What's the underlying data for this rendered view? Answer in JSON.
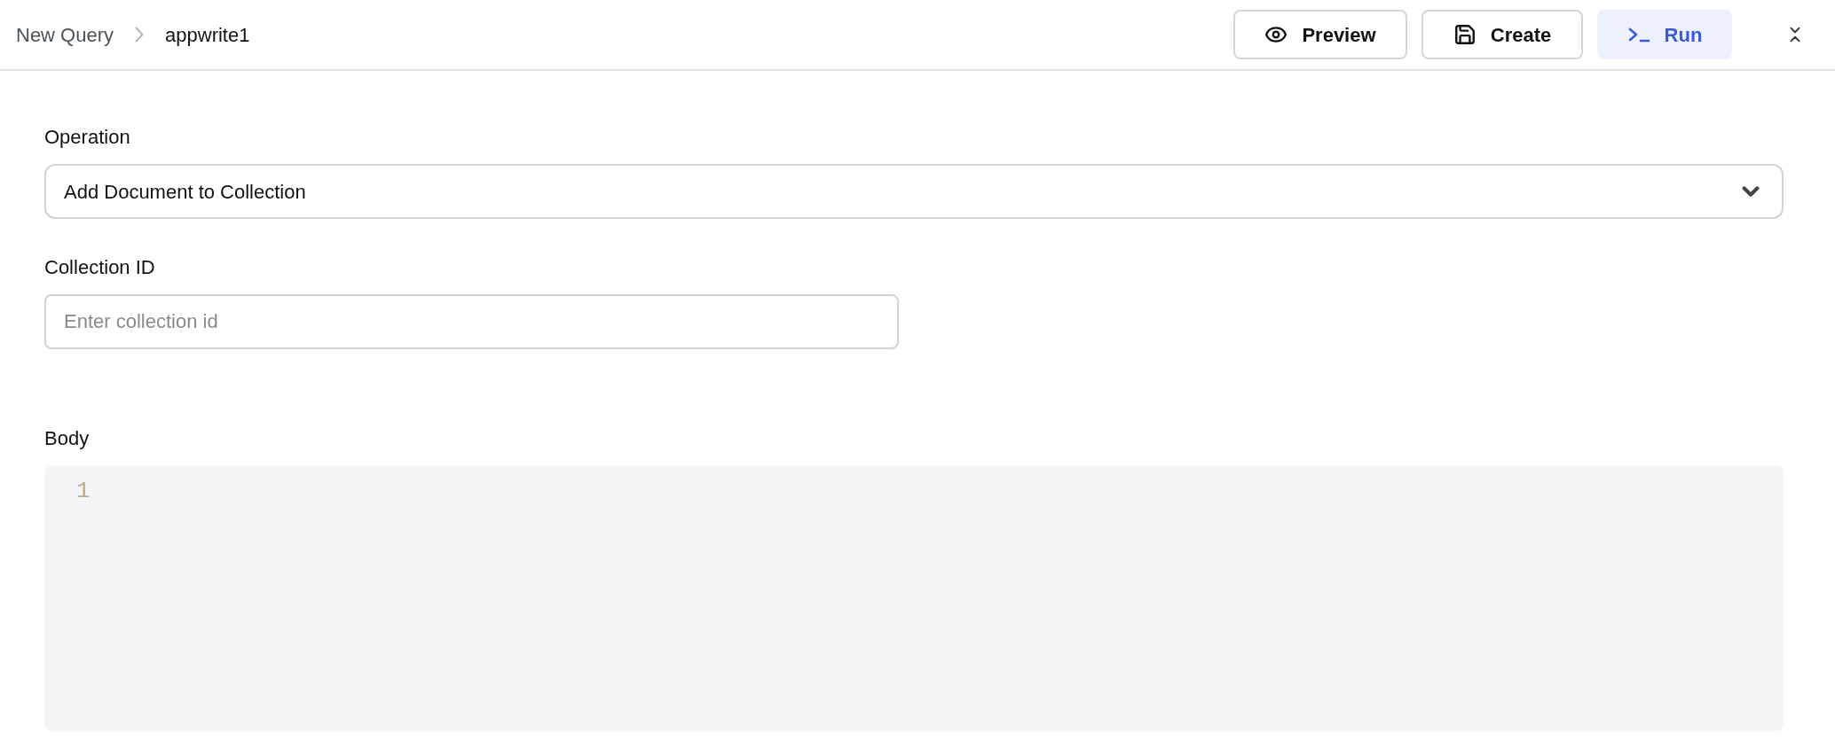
{
  "breadcrumb": {
    "parent": "New Query",
    "current": "appwrite1"
  },
  "actions": [
    {
      "kind": "preview",
      "label": "Preview"
    },
    {
      "kind": "create",
      "label": "Create"
    },
    {
      "kind": "run",
      "label": "Run"
    }
  ],
  "fields": [
    {
      "kind": "select",
      "label": "Operation",
      "value": "Add Document to Collection"
    },
    {
      "kind": "input",
      "label": "Collection ID",
      "placeholder": "Enter collection id"
    },
    {
      "kind": "code",
      "label": "Body",
      "line_numbers": [
        "1"
      ]
    }
  ]
}
